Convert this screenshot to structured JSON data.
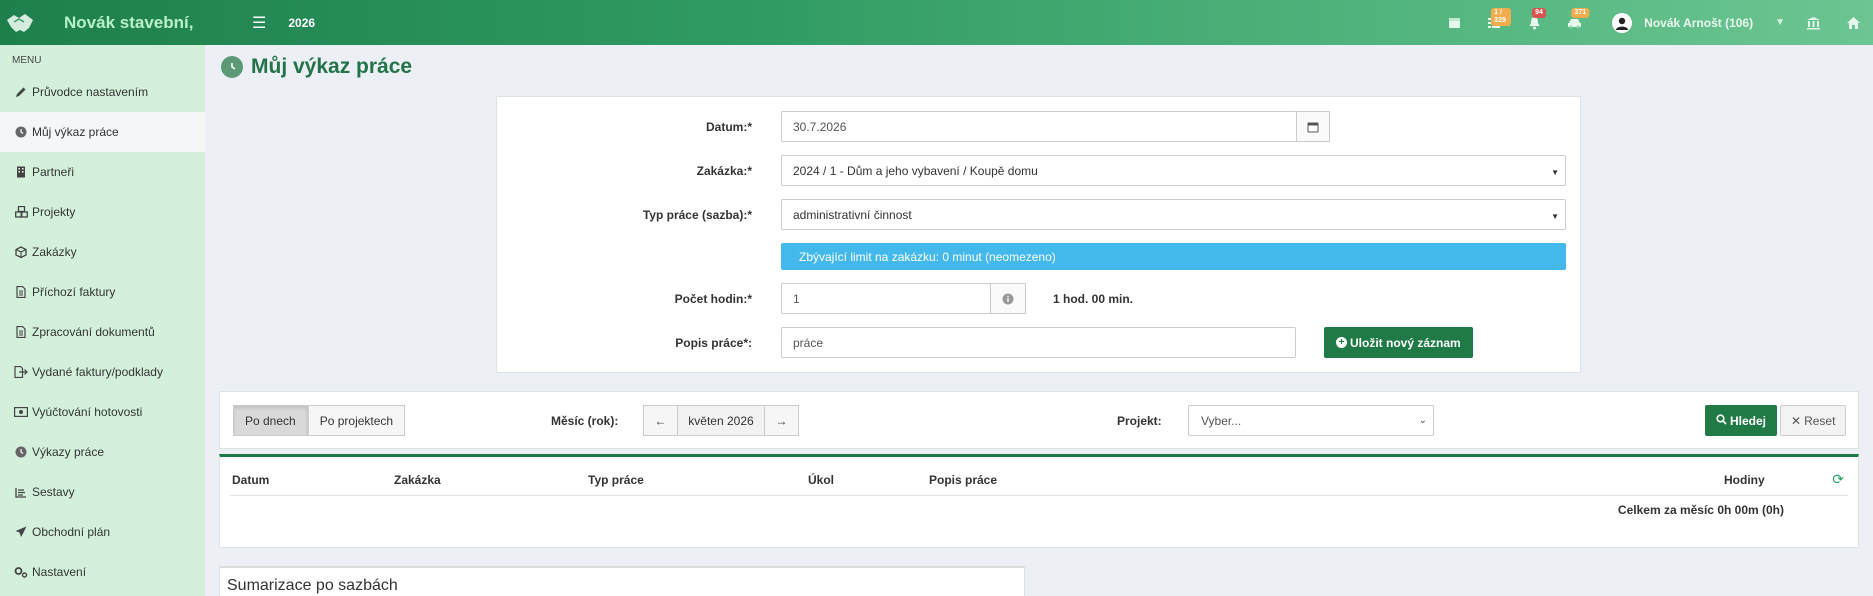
{
  "topbar": {
    "brand": "Novák stavební,",
    "year": "2026",
    "badges": {
      "tasks": "1 / 329",
      "notifications": "94",
      "vehicles": "371"
    },
    "user_name": "Novák Arnošt (106)"
  },
  "sidebar": {
    "heading": "MENU",
    "items": [
      {
        "label": "Průvodce nastavením",
        "icon": "pencil-icon"
      },
      {
        "label": "Můj výkaz práce",
        "icon": "clock-icon",
        "active": true
      },
      {
        "label": "Partneři",
        "icon": "building-icon"
      },
      {
        "label": "Projekty",
        "icon": "cubes-icon"
      },
      {
        "label": "Zakázky",
        "icon": "cube-icon"
      },
      {
        "label": "Příchozí faktury",
        "icon": "file-icon"
      },
      {
        "label": "Zpracování dokumentů",
        "icon": "file-icon"
      },
      {
        "label": "Vydané faktury/podklady",
        "icon": "export-icon"
      },
      {
        "label": "Vyúčtování hotovosti",
        "icon": "money-icon"
      },
      {
        "label": "Výkazy práce",
        "icon": "clock-icon"
      },
      {
        "label": "Sestavy",
        "icon": "list-icon"
      },
      {
        "label": "Obchodní plán",
        "icon": "paper-plane-icon"
      },
      {
        "label": "Nastavení",
        "icon": "cogs-icon"
      }
    ]
  },
  "page": {
    "title": "Můj výkaz práce"
  },
  "form": {
    "date_label": "Datum:*",
    "date_value": "30.7.2026",
    "order_label": "Zakázka:*",
    "order_value": "2024 / 1 - Dům a jeho vybavení / Koupě domu",
    "worktype_label": "Typ práce (sazba):*",
    "worktype_value": "administrativní činnost",
    "limit_alert": "Zbývající limit na zakázku: 0 minut (neomezeno)",
    "hours_label": "Počet hodin:*",
    "hours_value": "1",
    "hours_text": "1 hod. 00 min.",
    "desc_label": "Popis práce*:",
    "desc_value": "práce",
    "save_button": "Uložit nový záznam"
  },
  "filter": {
    "by_days": "Po dnech",
    "by_projects": "Po projektech",
    "month_label": "Měsíc (rok):",
    "month_value": "květen 2026",
    "project_label": "Projekt:",
    "project_placeholder": "Vyber...",
    "search_button": "Hledej",
    "reset_button": "Reset"
  },
  "table": {
    "columns": [
      "Datum",
      "Zakázka",
      "Typ práce",
      "Úkol",
      "Popis práce",
      "Hodiny"
    ],
    "total": "Celkem za měsíc 0h 00m (0h)"
  },
  "summary": {
    "title": "Sumarizace po sazbách"
  },
  "colors": {
    "primary": "#1f7a45",
    "info": "#42b9ea",
    "sidebar": "#d3f1da"
  }
}
